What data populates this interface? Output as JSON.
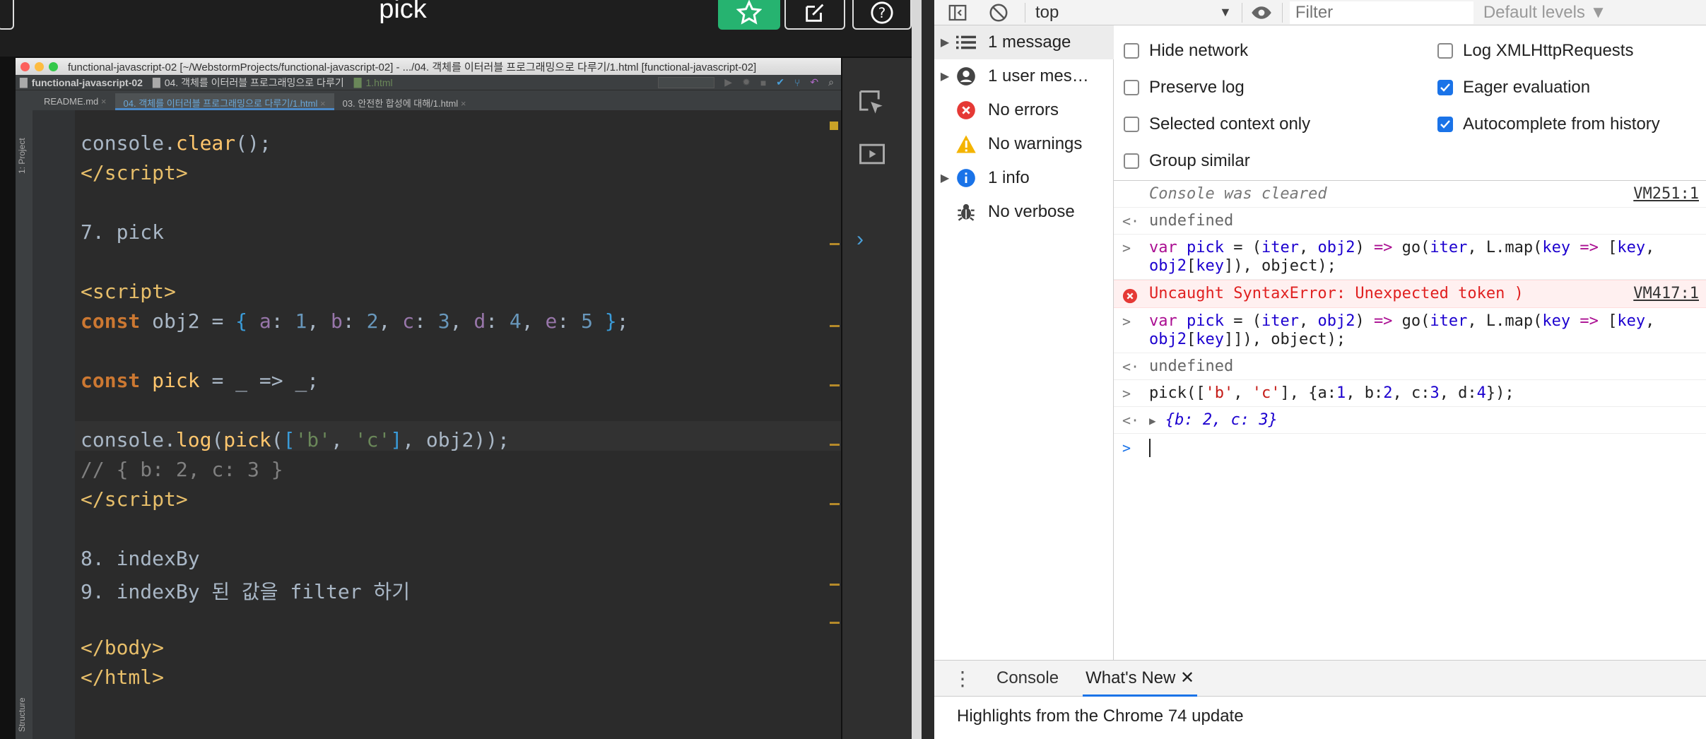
{
  "video": {
    "title": "pick"
  },
  "ide": {
    "window_title": "functional-javascript-02 [~/WebstormProjects/functional-javascript-02] - .../04. 객체를 이터러블 프로그래밍으로 다루기/1.html [functional-javascript-02]",
    "breadcrumbs": [
      "functional-javascript-02",
      "04. 객체를 이터러블 프로그래밍으로 다루기",
      "1.html"
    ],
    "tabs": [
      "README.md",
      "04. 객체를 이터러블 프로그래밍으로 다루기/1.html",
      "03. 안전한 합성에 대해/1.html"
    ],
    "side_labels": [
      "1: Project",
      "Structure"
    ]
  },
  "devtools": {
    "toolbar": {
      "context": "top",
      "filter_placeholder": "Filter",
      "levels": "Default levels ▼"
    },
    "sidebar": [
      {
        "label": "1 message",
        "icon": "list-icon",
        "has_arrow": true
      },
      {
        "label": "1 user mes…",
        "icon": "user-icon",
        "has_arrow": true
      },
      {
        "label": "No errors",
        "icon": "error-icon",
        "has_arrow": false
      },
      {
        "label": "No warnings",
        "icon": "warning-icon",
        "has_arrow": false
      },
      {
        "label": "1 info",
        "icon": "info-icon",
        "has_arrow": true
      },
      {
        "label": "No verbose",
        "icon": "bug-icon",
        "has_arrow": false
      }
    ],
    "settings": {
      "left": [
        {
          "label": "Hide network",
          "checked": false
        },
        {
          "label": "Preserve log",
          "checked": false
        },
        {
          "label": "Selected context only",
          "checked": false
        },
        {
          "label": "Group similar",
          "checked": false
        }
      ],
      "right": [
        {
          "label": "Log XMLHttpRequests",
          "checked": false
        },
        {
          "label": "Eager evaluation",
          "checked": true
        },
        {
          "label": "Autocomplete from history",
          "checked": true
        }
      ]
    },
    "console": {
      "cleared": "Console was cleared",
      "cleared_src": "VM251:1",
      "undefined": "undefined",
      "error": "Uncaught SyntaxError: Unexpected token )",
      "error_src": "VM417:1",
      "result": "{b: 2, c: 3}"
    },
    "drawer": {
      "tabs": [
        "Console",
        "What's New"
      ],
      "highlights": "Highlights from the Chrome 74 update"
    }
  }
}
